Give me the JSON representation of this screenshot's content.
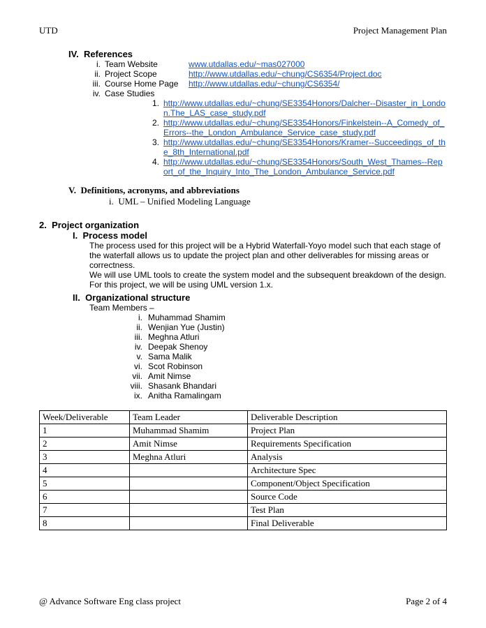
{
  "header": {
    "left": "UTD",
    "right": "Project Management Plan"
  },
  "sections": {
    "references": {
      "num": "IV.",
      "title": "References",
      "items": [
        {
          "n": "i.",
          "label": "Team Website",
          "link": "www.utdallas.edu/~mas027000"
        },
        {
          "n": "ii.",
          "label": "Project Scope",
          "link": "http://www.utdallas.edu/~chung/CS6354/Project.doc"
        },
        {
          "n": "iii.",
          "label": "Course Home Page",
          "link": "http://www.utdallas.edu/~chung/CS6354/"
        },
        {
          "n": "iv.",
          "label": "Case Studies",
          "link": ""
        }
      ],
      "case_studies": [
        {
          "n": "1.",
          "link": "http://www.utdallas.edu/~chung/SE3354Honors/Dalcher--Disaster_in_London.The_LAS_case_study.pdf"
        },
        {
          "n": "2.",
          "link": "http://www.utdallas.edu/~chung/SE3354Honors/Finkelstein--A_Comedy_of_Errors--the_London_Ambulance_Service_case_study.pdf"
        },
        {
          "n": "3.",
          "link": "http://www.utdallas.edu/~chung/SE3354Honors/Kramer--Succeedings_of_the_8th_International.pdf"
        },
        {
          "n": "4.",
          "link": "http://www.utdallas.edu/~chung/SE3354Honors/South_West_Thames--Report_of_the_Inquiry_Into_The_London_Ambulance_Service.pdf"
        }
      ]
    },
    "definitions": {
      "num": "V.",
      "title": "Definitions, acronyms, and abbreviations",
      "items": [
        {
          "n": "i.",
          "text": "UML – Unified Modeling Language"
        }
      ]
    },
    "project_org": {
      "num": "2.",
      "title": "Project organization",
      "process_model": {
        "num": "I.",
        "title": "Process model",
        "p1": "The process used for this project will be a Hybrid Waterfall-Yoyo model such that each stage of the waterfall allows us to update the project plan and other deliverables for missing areas or correctness.",
        "p2": "We will use UML tools to create the system model and the subsequent breakdown of the design. For this project, we will be using UML version 1.x."
      },
      "org_structure": {
        "num": "II.",
        "title": "Organizational structure",
        "lead": "Team Members –",
        "members": [
          {
            "n": "i.",
            "name": "Muhammad Shamim"
          },
          {
            "n": "ii.",
            "name": "Wenjian Yue (Justin)"
          },
          {
            "n": "iii.",
            "name": "Meghna Atluri"
          },
          {
            "n": "iv.",
            "name": "Deepak Shenoy"
          },
          {
            "n": "v.",
            "name": "Sama Malik"
          },
          {
            "n": "vi.",
            "name": "Scot Robinson"
          },
          {
            "n": "vii.",
            "name": "Amit Nimse"
          },
          {
            "n": "viii.",
            "name": "Shasank Bhandari"
          },
          {
            "n": "ix.",
            "name": "Anitha Ramalingam"
          }
        ]
      }
    }
  },
  "table": {
    "headers": [
      "Week/Deliverable",
      "Team Leader",
      "Deliverable Description"
    ],
    "rows": [
      [
        "1",
        "Muhammad Shamim",
        "Project Plan"
      ],
      [
        "2",
        "Amit Nimse",
        "Requirements Specification"
      ],
      [
        "3",
        "Meghna Atluri",
        "Analysis"
      ],
      [
        "4",
        "",
        "Architecture Spec"
      ],
      [
        "5",
        "",
        "Component/Object Specification"
      ],
      [
        "6",
        "",
        "Source Code"
      ],
      [
        "7",
        "",
        "Test Plan"
      ],
      [
        "8",
        "",
        "Final Deliverable"
      ]
    ]
  },
  "footer": {
    "left": "@ Advance Software Eng class project",
    "right": "Page 2 of 4"
  }
}
